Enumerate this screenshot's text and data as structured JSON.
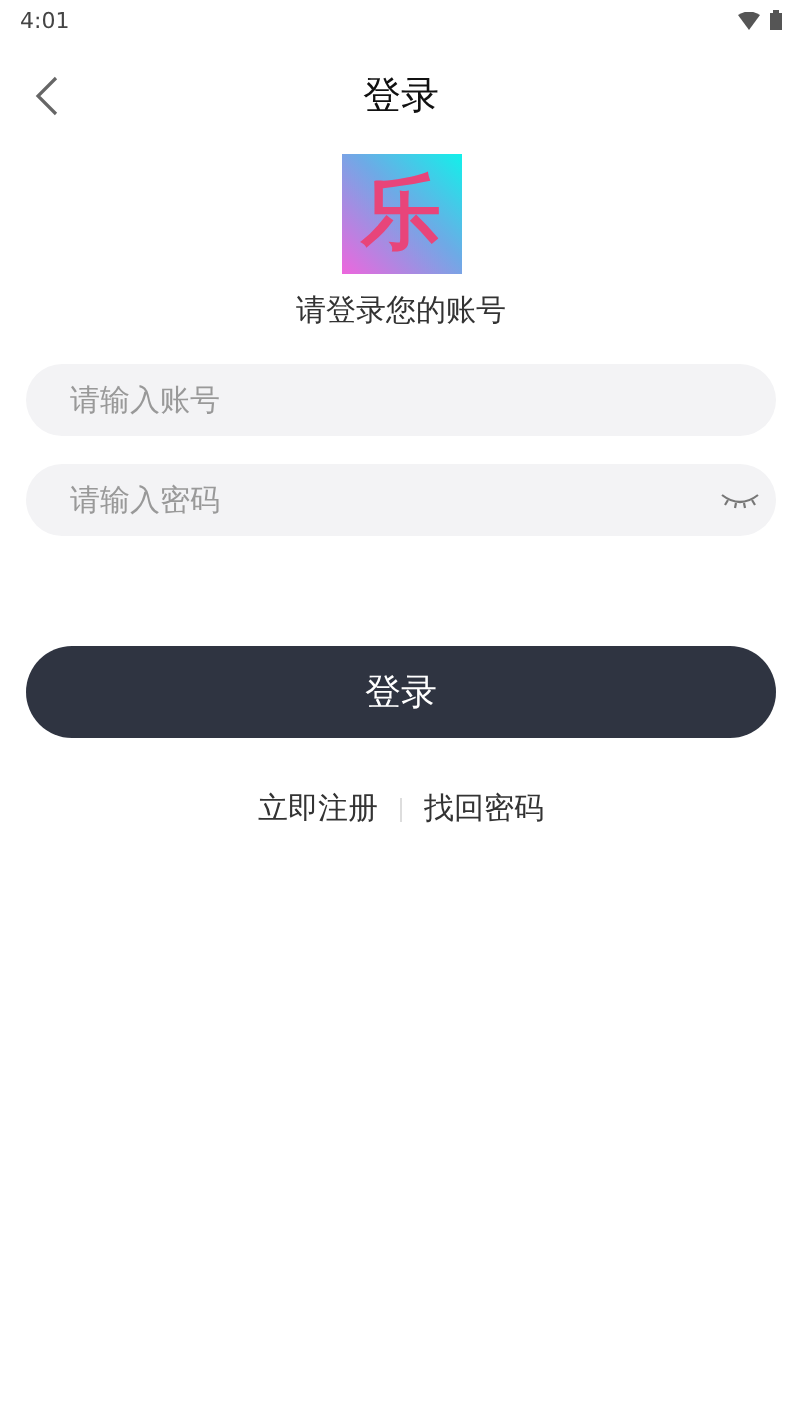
{
  "status_bar": {
    "time": "4:01"
  },
  "header": {
    "title": "登录"
  },
  "logo": {
    "glyph": "乐"
  },
  "subtitle": "请登录您的账号",
  "account_field": {
    "placeholder": "请输入账号"
  },
  "password_field": {
    "placeholder": "请输入密码",
    "password_visible": false
  },
  "login_button": "登录",
  "links": [
    "立即注册",
    "找回密码"
  ]
}
